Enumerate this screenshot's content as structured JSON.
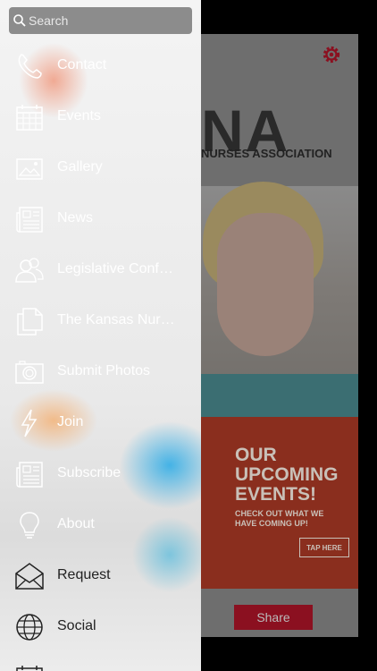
{
  "drawer": {
    "search": {
      "placeholder": "Search"
    },
    "items": [
      {
        "label": "Contact",
        "icon": "phone-icon"
      },
      {
        "label": "Events",
        "icon": "calendar-icon"
      },
      {
        "label": "Gallery",
        "icon": "image-icon"
      },
      {
        "label": "News",
        "icon": "newspaper-icon"
      },
      {
        "label": "Legislative Conf…",
        "icon": "users-icon"
      },
      {
        "label": "The Kansas Nur…",
        "icon": "document-icon"
      },
      {
        "label": "Submit Photos",
        "icon": "camera-icon"
      },
      {
        "label": "Join",
        "icon": "lightning-icon"
      },
      {
        "label": "Subscribe",
        "icon": "newspaper-icon"
      },
      {
        "label": "About",
        "icon": "lightbulb-icon"
      },
      {
        "label": "Request",
        "icon": "envelope-icon"
      },
      {
        "label": "Social",
        "icon": "globe-icon"
      }
    ]
  },
  "app": {
    "logo_text": "NA",
    "logo_subtitle": "NURSES ASSOCIATION",
    "promo": {
      "title": "OUR\nUPCOMING\nEVENTS!",
      "description": "CHECK OUT WHAT WE\nHAVE COMING UP!",
      "tap_label": "TAP HERE"
    },
    "share_label": "Share",
    "accent_color": "#8b1020"
  }
}
